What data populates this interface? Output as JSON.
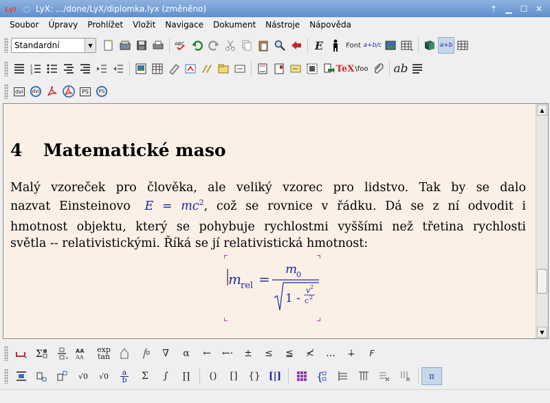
{
  "window": {
    "title": "LyX: .../done/LyX/diplomka.lyx (změněno)"
  },
  "menu": [
    "Soubor",
    "Úpravy",
    "Prohlížet",
    "Vložit",
    "Navigace",
    "Dokument",
    "Nástroje",
    "Nápověda"
  ],
  "toolbar_main": {
    "layout_select": "Standardní",
    "font_label": "Font",
    "fraction_label": "a+b/c"
  },
  "toolbar_extra": {
    "tex_label": "TeX",
    "foo_label": "\\foo",
    "ab_label": "ab"
  },
  "toolbar_view": [
    "dvi",
    "dvi",
    "pdf",
    "pdf",
    "PS",
    "PS"
  ],
  "document": {
    "section_number": "4",
    "section_title": "Matematické maso",
    "para_line1": "Malý vzoreček pro člověka, ale veliký vzorec pro lidstvo. Tak by se dalo",
    "para_line2_before": "nazvat Einsteinovo",
    "para_line2_math": "E = mc",
    "para_line2_exp": "2",
    "para_line2_after": ", což se rovnice v řádku. Dá se z ní odvodit i",
    "para_line3": "hmotnost objektu, který se pohybuje rychlostmi vyššími než třetina rychlosti",
    "para_line4": "světla -- relativistickými. Říká se jí relativistická hmotnost:",
    "equation": {
      "lhs": "m",
      "lhs_sub": "rel",
      "equals": "=",
      "numerator": "m",
      "numerator_sub": "0",
      "radicand_one": "1 -",
      "v": "v",
      "v_exp": "2",
      "c": "c",
      "c_exp": "2"
    }
  },
  "math_toolbar_row1": [
    "exp",
    "tan",
    "α",
    "←",
    "←·",
    "±",
    "≤",
    "≦",
    "≮",
    "…",
    "∔",
    "F"
  ],
  "math_toolbar_row2": [
    "√0",
    "√0",
    "a",
    "b",
    "Σ",
    "∫",
    "∏",
    "()",
    "[]",
    "{}",
    "[|]",
    "π"
  ]
}
